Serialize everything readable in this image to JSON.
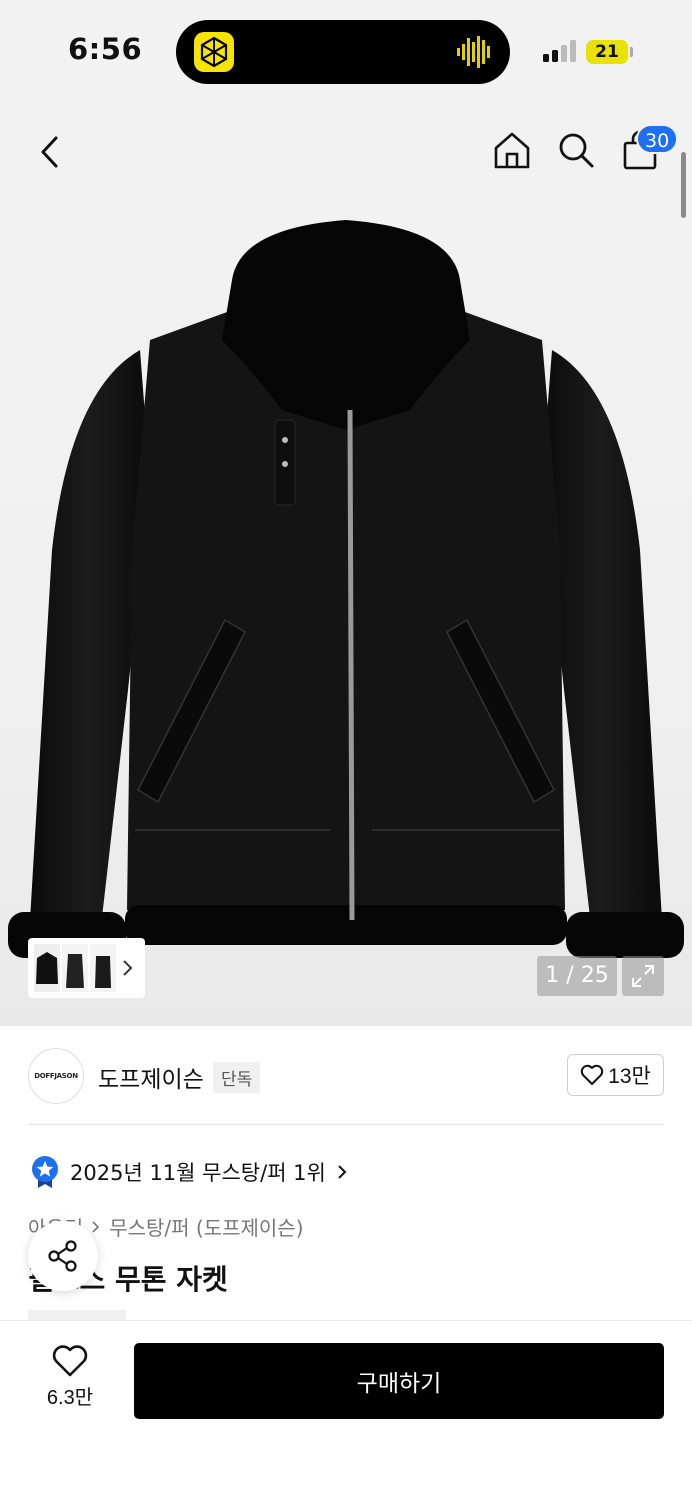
{
  "status_bar": {
    "time": "6:56",
    "battery": "21"
  },
  "header": {
    "cart_count": "30"
  },
  "gallery": {
    "counter": "1 / 25"
  },
  "brand": {
    "logo_text": "DOFFJASON",
    "name": "도프제이슨",
    "tag": "단독",
    "likes": "13만"
  },
  "ranking": {
    "text": "2025년 11월 무스탕/퍼 1위"
  },
  "breadcrumb": {
    "level1": "아우터",
    "level2": "무스탕/퍼 (도프제이슨)"
  },
  "product": {
    "title": "필드스 무톤 자켓"
  },
  "bottom": {
    "like_count": "6.3만",
    "buy_label": "구매하기"
  },
  "colors": {
    "accent_blue": "#1f6ff2",
    "buy_button": "#000000",
    "island_logo": "#f5e400"
  }
}
